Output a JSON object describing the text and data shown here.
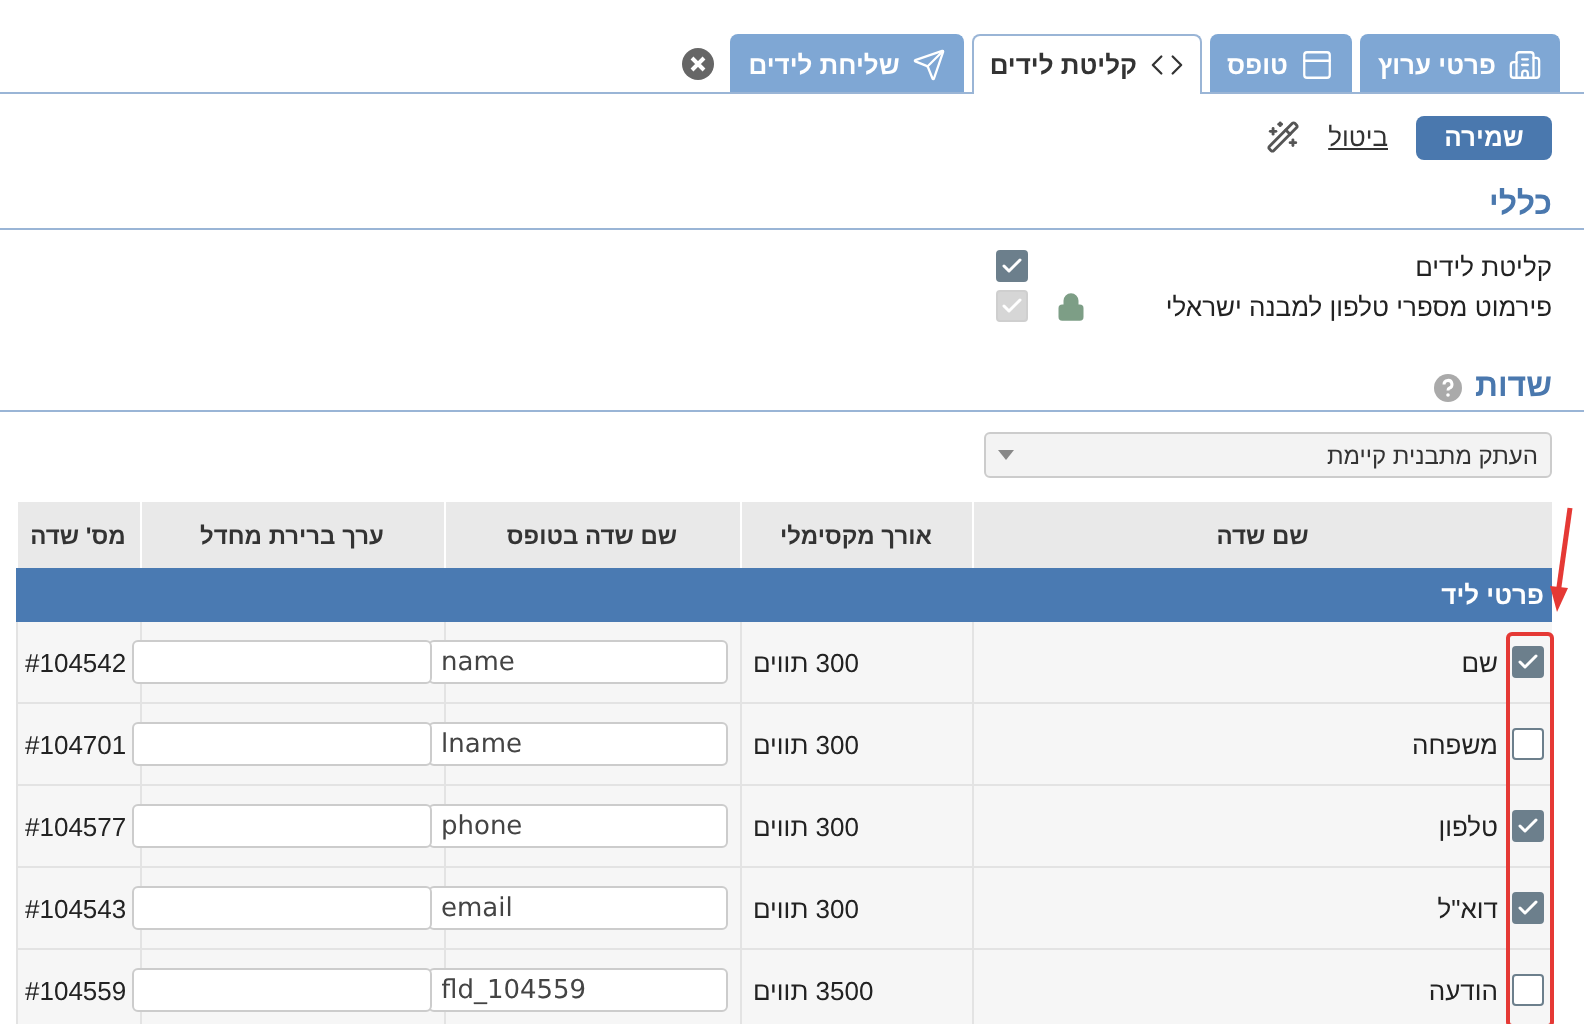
{
  "tabs": [
    {
      "label": "פרטי ערוץ",
      "selected": false
    },
    {
      "label": "טופס",
      "selected": false
    },
    {
      "label": "קליטת לידים",
      "selected": true
    },
    {
      "label": "שליחת לידים",
      "selected": false
    }
  ],
  "toolbar": {
    "save": "שמירה",
    "cancel": "ביטול"
  },
  "general": {
    "title": "כללי",
    "options": [
      {
        "label": "קליטת לידים",
        "checked": true,
        "disabled": false,
        "locked": false
      },
      {
        "label": "פירמוט מספרי טלפון למבנה ישראלי",
        "checked": true,
        "disabled": true,
        "locked": true
      }
    ]
  },
  "fields": {
    "title": "שדות",
    "template_select": {
      "value": "העתק מתבנית קיימת"
    },
    "table": {
      "columns": [
        "שם שדה",
        "אורך מקסימלי",
        "שם שדה בטופס",
        "ערך ברירת מחדל",
        "מס' שדה"
      ],
      "groups": [
        {
          "title": "פרטי ליד",
          "rows": [
            {
              "checked": true,
              "name": "שם",
              "max_length": "300 תווים",
              "form_field": "name",
              "field_number": "#104542"
            },
            {
              "checked": false,
              "name": "משפחה",
              "max_length": "300 תווים",
              "form_field": "lname",
              "field_number": "#104701"
            },
            {
              "checked": true,
              "name": "טלפון",
              "max_length": "300 תווים",
              "form_field": "phone",
              "field_number": "#104577"
            },
            {
              "checked": true,
              "name": "דוא\"ל",
              "max_length": "300 תווים",
              "form_field": "email",
              "field_number": "#104543"
            },
            {
              "checked": false,
              "name": "הודעה",
              "max_length": "3500 תווים",
              "form_field": "fld_104559",
              "field_number": "#104559"
            }
          ]
        }
      ]
    }
  }
}
